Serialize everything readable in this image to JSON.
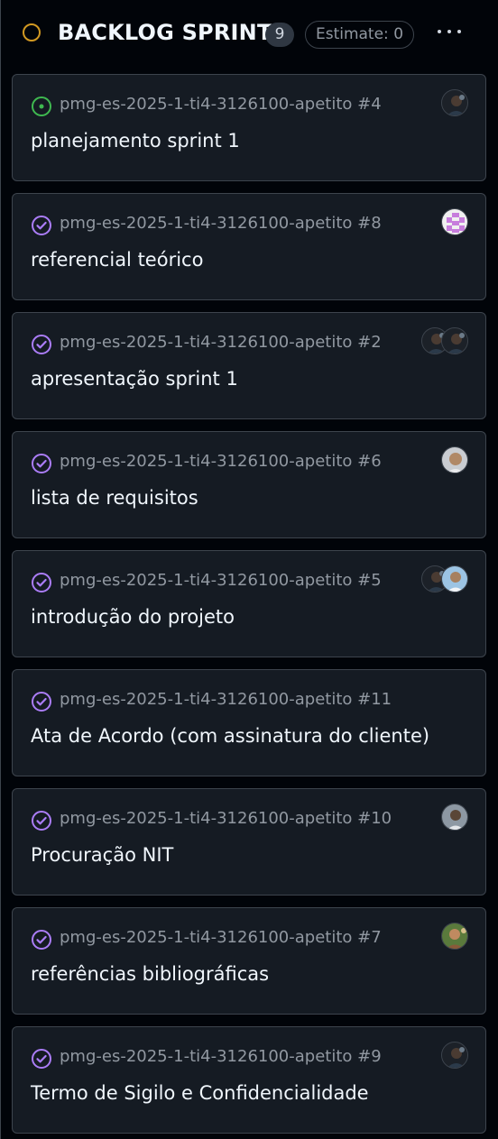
{
  "column": {
    "title": "BACKLOG SPRINT",
    "count": "9",
    "estimate": "Estimate: 0",
    "status_color": "#d29922"
  },
  "colors": {
    "open": "#3fb950",
    "closed": "#ab7df8"
  },
  "cards": [
    {
      "ref": "pmg-es-2025-1-ti4-3126100-apetito #4",
      "title": "planejamento sprint 1",
      "state": "open",
      "avatars": [
        "photo-dark"
      ]
    },
    {
      "ref": "pmg-es-2025-1-ti4-3126100-apetito #8",
      "title": "referencial teórico",
      "state": "closed",
      "avatars": [
        "identicon-pink"
      ]
    },
    {
      "ref": "pmg-es-2025-1-ti4-3126100-apetito #2",
      "title": "apresentação sprint 1",
      "state": "closed",
      "avatars": [
        "photo-dark",
        "photo-dark"
      ]
    },
    {
      "ref": "pmg-es-2025-1-ti4-3126100-apetito #6",
      "title": "lista de requisitos",
      "state": "closed",
      "avatars": [
        "photo-light"
      ]
    },
    {
      "ref": "pmg-es-2025-1-ti4-3126100-apetito #5",
      "title": "introdução do projeto",
      "state": "closed",
      "avatars": [
        "photo-dark",
        "photo-blue"
      ]
    },
    {
      "ref": "pmg-es-2025-1-ti4-3126100-apetito #11",
      "title": "Ata de Acordo (com assinatura do cliente)",
      "state": "closed",
      "avatars": []
    },
    {
      "ref": "pmg-es-2025-1-ti4-3126100-apetito #10",
      "title": "Procuração NIT",
      "state": "closed",
      "avatars": [
        "photo-gray"
      ]
    },
    {
      "ref": "pmg-es-2025-1-ti4-3126100-apetito #7",
      "title": "referências bibliográficas",
      "state": "closed",
      "avatars": [
        "photo-green"
      ]
    },
    {
      "ref": "pmg-es-2025-1-ti4-3126100-apetito #9",
      "title": "Termo de Sigilo e Confidencialidade",
      "state": "closed",
      "avatars": [
        "photo-dark"
      ]
    }
  ]
}
